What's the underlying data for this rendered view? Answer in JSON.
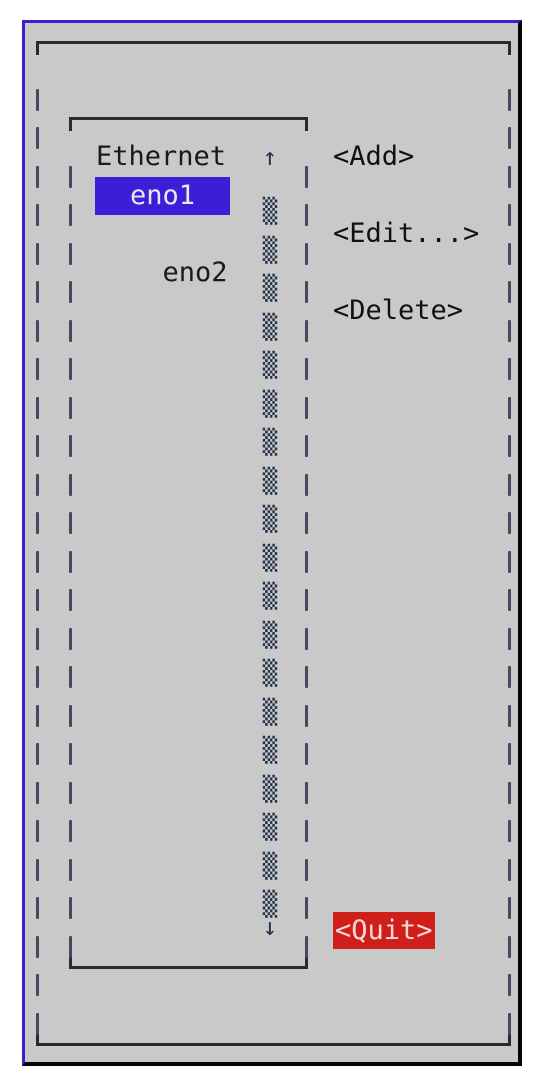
{
  "list": {
    "header": "Ethernet",
    "items": [
      {
        "label": "eno1",
        "selected": true
      },
      {
        "label": "eno2",
        "selected": false
      }
    ]
  },
  "scrollbar": {
    "up_icon": "↑",
    "down_icon": "↓",
    "track_glyph": "▒",
    "track_rows": 19
  },
  "buttons": {
    "add": "<Add>",
    "edit": "<Edit...>",
    "delete": "<Delete>",
    "quit": "<Quit>"
  },
  "colors": {
    "background": "#c9c9c9",
    "selection": "#3b1fd6",
    "quit": "#cf1f1a",
    "frame_highlight": "#3a1fd0"
  }
}
